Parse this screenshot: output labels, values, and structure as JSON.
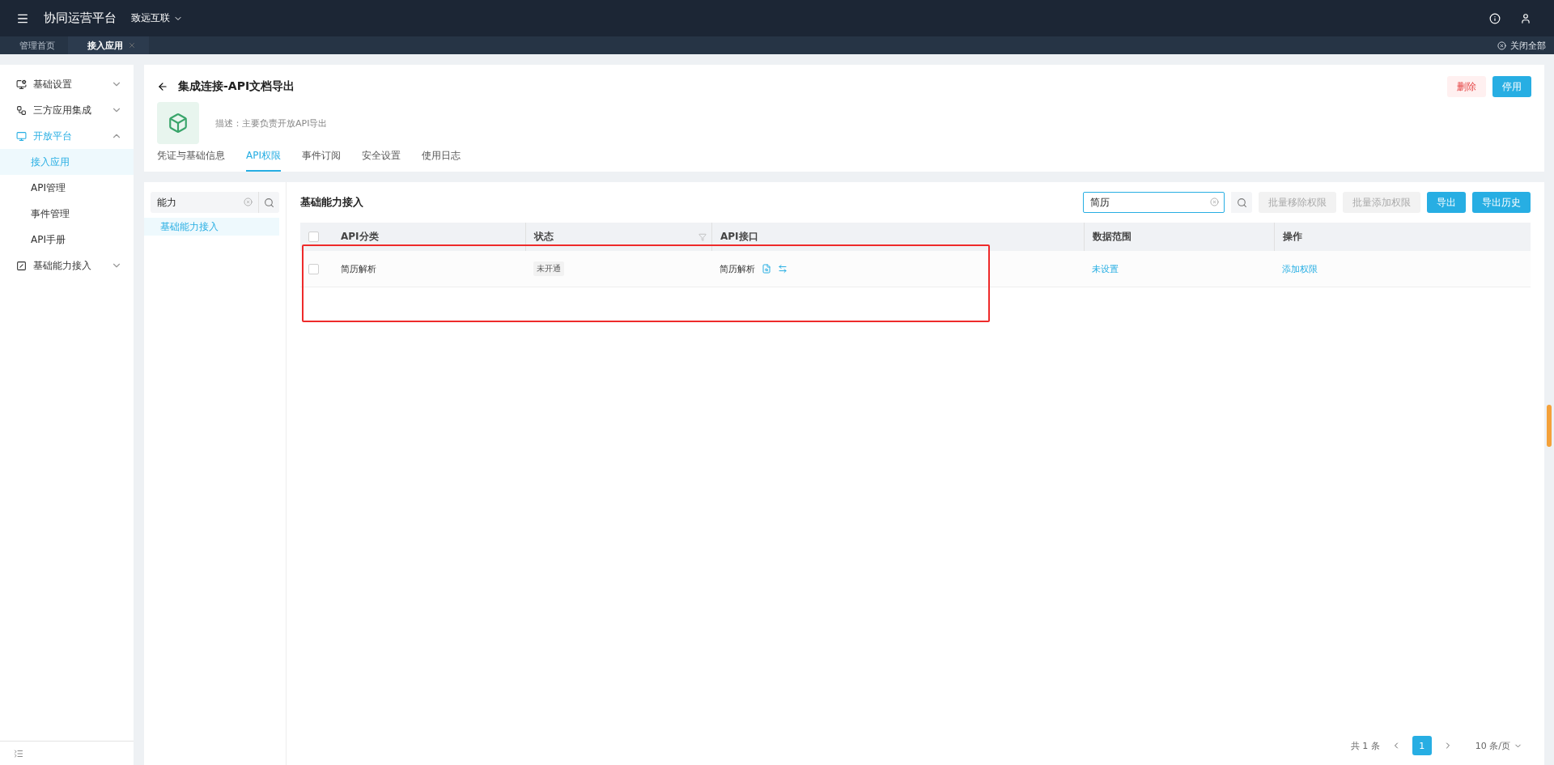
{
  "topbar": {
    "title": "协同运营平台",
    "org": "致远互联"
  },
  "page_tabs": [
    {
      "label": "管理首页",
      "selected": false,
      "closable": false
    },
    {
      "label": "接入应用",
      "selected": true,
      "closable": true
    }
  ],
  "close_all": "关闭全部",
  "sidebar": {
    "items": [
      {
        "label": "基础设置",
        "expanded": false,
        "selected": false
      },
      {
        "label": "三方应用集成",
        "expanded": false,
        "selected": false
      },
      {
        "label": "开放平台",
        "expanded": true,
        "selected": true,
        "children": [
          {
            "label": "接入应用",
            "selected": true
          },
          {
            "label": "API管理",
            "selected": false
          },
          {
            "label": "事件管理",
            "selected": false
          },
          {
            "label": "API手册",
            "selected": false
          }
        ]
      },
      {
        "label": "基础能力接入",
        "expanded": false,
        "selected": false
      }
    ]
  },
  "app": {
    "title": "集成连接-API文档导出",
    "description": "描述：主要负责开放API导出",
    "buttons": [
      {
        "label": "删除",
        "kind": "danger"
      },
      {
        "label": "停用",
        "kind": "primary"
      }
    ],
    "tabs": [
      {
        "label": "凭证与基础信息",
        "selected": false
      },
      {
        "label": "API权限",
        "selected": true
      },
      {
        "label": "事件订阅",
        "selected": false
      },
      {
        "label": "安全设置",
        "selected": false
      },
      {
        "label": "使用日志",
        "selected": false
      }
    ]
  },
  "tree": {
    "search": "能力",
    "items": [
      {
        "label": "基础能力接入",
        "selected": true
      }
    ]
  },
  "table": {
    "title": "基础能力接入",
    "search": "简历",
    "buttons": [
      {
        "label": "批量移除权限",
        "kind": "disabled"
      },
      {
        "label": "批量添加权限",
        "kind": "disabled"
      },
      {
        "label": "导出",
        "kind": "primary"
      },
      {
        "label": "导出历史",
        "kind": "primary"
      }
    ],
    "all_checked": false,
    "columns": [
      "API分类",
      "状态",
      "API接口",
      "数据范围",
      "操作"
    ],
    "rows": [
      {
        "checked": false,
        "category": "简历解析",
        "status": "未开通",
        "api": "简历解析",
        "scope": "未设置",
        "action": "添加权限"
      }
    ]
  },
  "pagination": {
    "total": "共 1 条",
    "pages": [
      {
        "label": "1",
        "selected": true
      }
    ],
    "page_size": "10 条/页"
  }
}
